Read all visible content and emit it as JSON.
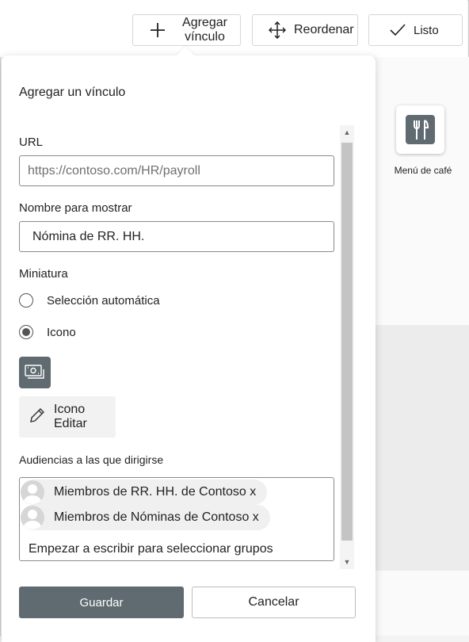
{
  "toolbar": {
    "add_link_label": "Agregar vínculo",
    "reorder_label": "Reordenar",
    "done_label": "Listo"
  },
  "tile": {
    "label": "Menú de café",
    "icon": "fork-knife-icon"
  },
  "panel": {
    "title": "Agregar un vínculo",
    "url_label": "URL",
    "url_placeholder": "https://contoso.com/HR/payroll",
    "display_name_label": "Nombre para mostrar",
    "display_name_value": "Nómina de RR. HH.",
    "thumbnail_label": "Miniatura",
    "options": [
      {
        "label": "Selección automática",
        "selected": false
      },
      {
        "label": "Icono",
        "selected": true
      }
    ],
    "selected_icon": "money-icon",
    "edit_icon_label": "Icono Editar",
    "audiences_label": "Audiencias a las que dirigirse",
    "audiences": [
      {
        "label": "Miembros de RR. HH. de Contoso x"
      },
      {
        "label": "Miembros de Nóminas de Contoso x"
      }
    ],
    "audience_placeholder": "Empezar a escribir para seleccionar grupos",
    "save_label": "Guardar",
    "cancel_label": "Cancelar"
  },
  "colors": {
    "primary_button": "#5f6b70",
    "icon_background": "#5f6b70"
  }
}
